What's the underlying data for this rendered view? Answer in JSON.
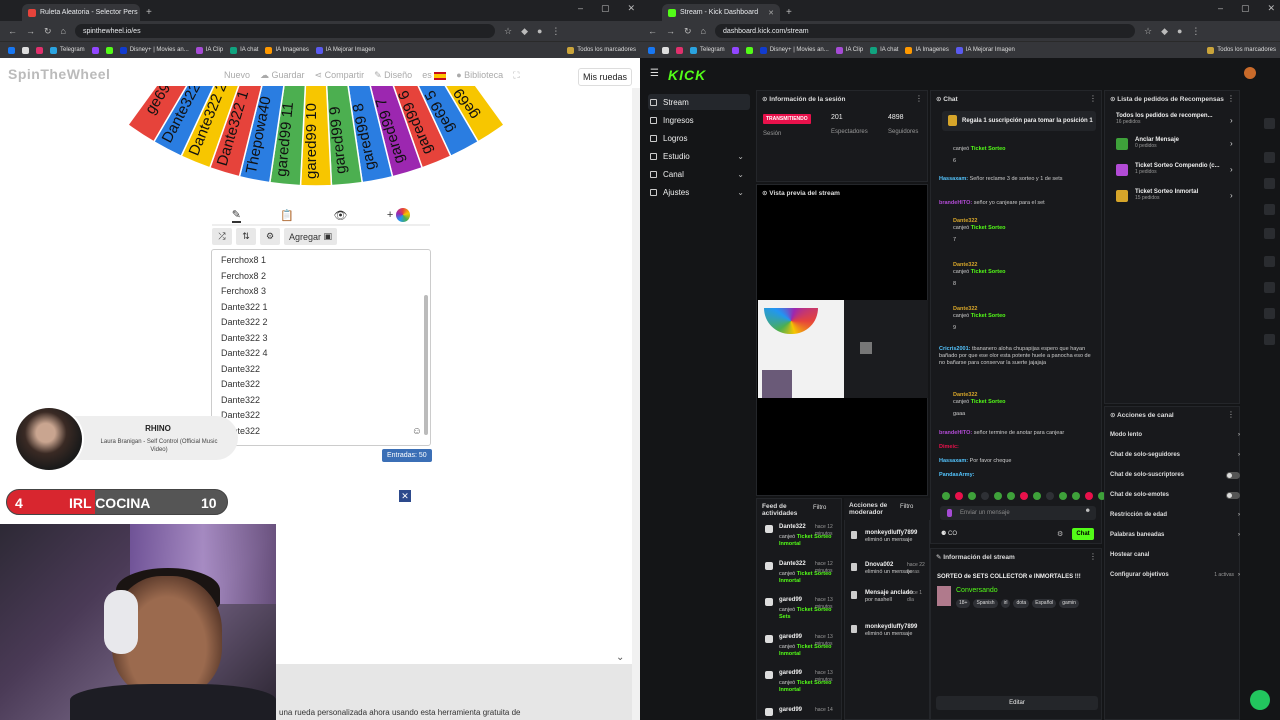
{
  "left_browser": {
    "tab_title": "Ruleta Aleatoria - Selector Pers",
    "url": "spinthewheel.io/es",
    "bookmarks": [
      "Telegram",
      "Disney+ | Movies an...",
      "IA Clip",
      "IA chat",
      "IA Imagenes",
      "IA Mejorar Imagen",
      "Todos los marcadores"
    ]
  },
  "spinwheel": {
    "logo": "SpinTheWheel",
    "nav": {
      "new": "Nuevo",
      "save": "Guardar",
      "share": "Compartir",
      "design": "Diseño",
      "lang": "es",
      "library": "Biblioteca"
    },
    "my_wheels": "Mis ruedas",
    "wheel_labels": [
      "ge69 4",
      "ge69 5",
      "gared99 6",
      "gared99 7",
      "gared99 8",
      "gared99 9",
      "gared99 10",
      "gared99 11",
      "Thepowa40",
      "Dante322 1",
      "Dante322 2",
      "Dante322 3",
      "ge69 1"
    ],
    "add_button": "Agregar",
    "entries": [
      "Ferchox8 1",
      "Ferchox8 2",
      "Ferchox8 3",
      "Dante322 1",
      "Dante322 2",
      "Dante322 3",
      "Dante322 4",
      "Dante322",
      "Dante322",
      "Dante322",
      "Dante322",
      "Dante322"
    ],
    "entries_count": "Entradas: 50",
    "bottom_text": "una rueda personalizada ahora usando esta herramienta gratuita de"
  },
  "overlay": {
    "now_playing_title": "RHINO",
    "now_playing_song": "Laura Branigan - Self Control (Official Music Video)",
    "goal_left": "4",
    "goal_name": "IRL COCINA",
    "goal_right": "10",
    "goal_progress": 0.4
  },
  "right_browser": {
    "tab_title": "Stream - Kick Dashboard",
    "url": "dashboard.kick.com/stream",
    "bookmarks": [
      "Telegram",
      "Disney+ | Movies an...",
      "IA Clip",
      "IA chat",
      "IA Imagenes",
      "IA Mejorar Imagen",
      "Todos los marcadores"
    ]
  },
  "kick": {
    "logo": "KICK",
    "nav": [
      {
        "label": "Stream",
        "selected": true
      },
      {
        "label": "Ingresos"
      },
      {
        "label": "Logros"
      },
      {
        "label": "Estudio",
        "chevron": true
      },
      {
        "label": "Canal",
        "chevron": true
      },
      {
        "label": "Ajustes",
        "chevron": true
      }
    ],
    "session": {
      "title": "Información de la sesión",
      "live_badge": "TRANSMITIENDO",
      "session_label": "Sesión",
      "viewers": "201",
      "viewers_label": "Espectadores",
      "followers": "4898",
      "followers_label": "Seguidores"
    },
    "preview_title": "Vista previa del stream",
    "chat": {
      "title": "Chat",
      "pinned": "Regala 1 suscripción para tomar la posición 1",
      "messages": [
        {
          "user": "",
          "text": "canjeó",
          "reward": "Ticket Sorteo",
          "extra": "6"
        },
        {
          "user": "Hassaxam:",
          "text": "Señor reclame 3 de sorteo y 1 de sets"
        },
        {
          "user": "brandeHITO:",
          "text": "señor yo canjeare para el set"
        },
        {
          "user": "Dante322",
          "text": "canjeó",
          "reward": "Ticket Sorteo",
          "extra": "7"
        },
        {
          "user": "Dante322",
          "text": "canjeó",
          "reward": "Ticket Sorteo",
          "extra": "8"
        },
        {
          "user": "Dante322",
          "text": "canjeó",
          "reward": "Ticket Sorteo",
          "extra": "9"
        },
        {
          "user": "Cricris2001:",
          "text": "tbananero aloha chupapijas espero que hayan bañado por que ese olor esta potente huele a panocha eso de no bañarse para conservar la suerte jajajaja"
        },
        {
          "user": "Dante322",
          "text": "canjeó",
          "reward": "Ticket Sorteo",
          "extra": "gaaa"
        },
        {
          "user": "brandeHITO:",
          "text": "señor termine de anotar para canjear"
        },
        {
          "user": "Dimeic:",
          "text": ""
        },
        {
          "user": "Hassaxam:",
          "text": "Por favor cheque"
        },
        {
          "user": "PandasArmy:",
          "text": ""
        }
      ],
      "input_placeholder": "Enviar un mensaje",
      "send_label": "Chat",
      "counter": "CO"
    },
    "activity": {
      "title": "Feed de actividades",
      "filter": "Filtro",
      "items": [
        {
          "user": "Dante322",
          "time": "hace 12 minutos",
          "text": "canjeó",
          "reward": "Ticket Sorteo Inmortal"
        },
        {
          "user": "Dante322",
          "time": "hace 12 minutos",
          "text": "canjeó",
          "reward": "Ticket Sorteo Inmortal"
        },
        {
          "user": "gared99",
          "time": "hace 13 minutos",
          "text": "canjeó",
          "reward": "Ticket Sorteo Sets"
        },
        {
          "user": "gared99",
          "time": "hace 13 minutos",
          "text": "canjeó",
          "reward": "Ticket Sorteo Inmortal"
        },
        {
          "user": "gared99",
          "time": "hace 13 minutos",
          "text": "canjeó",
          "reward": "Ticket Sorteo Inmortal"
        },
        {
          "user": "gared99",
          "time": "hace 14",
          "text": "",
          "reward": ""
        }
      ]
    },
    "modactions": {
      "title": "Acciones de moderador",
      "filter": "Filtro",
      "items": [
        {
          "user": "monkeydluffy7899",
          "text": "eliminó un mensaje",
          "time": ""
        },
        {
          "user": "Dnova002",
          "text": "eliminó un mensaje",
          "time": "hace 22 horas"
        },
        {
          "user": "Mensaje anclado",
          "text": "por nashell",
          "time": "hace 1 día"
        },
        {
          "user": "monkeydluffy7899",
          "text": "eliminó un mensaje",
          "time": ""
        }
      ]
    },
    "stream_info": {
      "title": "Información del stream",
      "stream_title": "SORTEO de SETS COLLECTOR e INMORTALES !!!",
      "category": "Conversando",
      "tags": [
        "18+",
        "Spanish",
        "irl",
        "dota",
        "Español",
        "gamin"
      ],
      "edit_button": "Editar"
    },
    "rewards": {
      "title": "Lista de pedidos de Recompensas",
      "all_label": "Todos los pedidos de recompen...",
      "all_count": "16 pedidos",
      "items": [
        {
          "name": "Anclar Mensaje",
          "count": "0 pedidos",
          "color": "#3ea13a"
        },
        {
          "name": "Ticket Sorteo Compendio (c...",
          "count": "1 pedidos",
          "color": "#b24bd6"
        },
        {
          "name": "Ticket Sorteo Inmortal",
          "count": "15 pedidos",
          "color": "#d6a52a"
        }
      ]
    },
    "channel_actions": {
      "title": "Acciones de canal",
      "items": [
        {
          "label": "Modo lento",
          "type": "chevron"
        },
        {
          "label": "Chat de solo-seguidores",
          "type": "chevron"
        },
        {
          "label": "Chat de solo-suscriptores",
          "type": "toggle"
        },
        {
          "label": "Chat de solo-emotes",
          "type": "toggle"
        },
        {
          "label": "Restricción de edad",
          "type": "chevron"
        },
        {
          "label": "Palabras baneadas",
          "type": "chevron"
        },
        {
          "label": "Hostear canal",
          "type": "none"
        },
        {
          "label": "Configurar objetivos",
          "type": "chevron",
          "extra": "1 activas"
        }
      ]
    }
  }
}
